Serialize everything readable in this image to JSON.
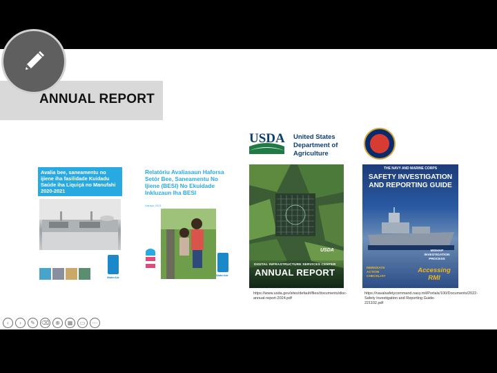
{
  "slide": {
    "title": "ANNUAL REPORT"
  },
  "edit_button": {
    "icon": "pencil-icon"
  },
  "cover1": {
    "heading": "Avalia bee, saneamentu no ijiene iha fasilidade Kuidadu Saúde iha Liquiçá no Manufahi 2020-2021",
    "logo_text": "WaterAid",
    "accent": "#29a9e1"
  },
  "cover2": {
    "title": "Relatóriu Avaliasaun Haforsa Setór Bee, Saneamentu No Ijiene (BESI) No Ekuidade Inkluzaun Iha BESI",
    "subtitle": "Liquiçá, 2021",
    "logo_text": "WaterAid"
  },
  "cover3": {
    "logo_text": "USDA",
    "agency_lines": [
      "United States",
      "Department of",
      "Agriculture"
    ],
    "cover_small": "DIGITAL INFRASTRUCTURE SERVICES CENTER",
    "cover_big": "ANNUAL REPORT",
    "cover_logo": "USDA",
    "caption": "https://www.usda.gov/sites/default/files/documents/disc-annual-report-2024.pdf"
  },
  "cover4": {
    "top_line": "THE NAVY AND MARINE CORPS",
    "title_line1": "SAFETY INVESTIGATION",
    "title_line2": "AND REPORTING GUIDE",
    "right_text": "MISHAP INVESTIGATION PROCESS",
    "accessing": "Accessing RMI",
    "left_text": "IMMEDIATE ACTION CHECKLIST",
    "caption": "https://navalsafetycommand.navy.mil/Portals/100/Documents/2022-Safety Investigation and Reporting Guide-221102.pdf"
  },
  "toolbar": {
    "buttons": [
      "prev-icon",
      "next-icon",
      "pen-icon",
      "highlighter-icon",
      "zoom-icon",
      "grid-icon",
      "subtitles-icon",
      "more-icon"
    ]
  }
}
